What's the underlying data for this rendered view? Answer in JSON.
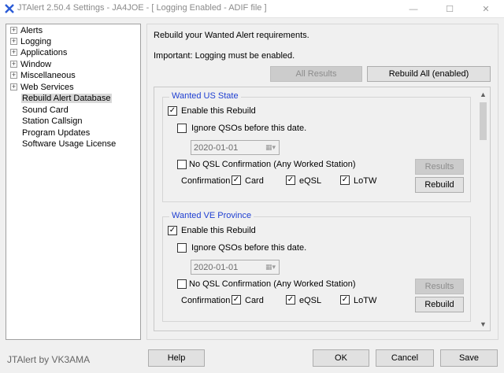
{
  "window": {
    "title": "JTAlert 2.50.4 Settings  -  JA4JOE  -  [ Logging Enabled - ADIF file ]",
    "minimize": "—",
    "maximize": "☐",
    "close": "✕"
  },
  "tree": {
    "items": [
      {
        "label": "Alerts",
        "expandable": true
      },
      {
        "label": "Logging",
        "expandable": true
      },
      {
        "label": "Applications",
        "expandable": true
      },
      {
        "label": "Window",
        "expandable": true
      },
      {
        "label": "Miscellaneous",
        "expandable": true
      },
      {
        "label": "Web Services",
        "expandable": true
      },
      {
        "label": "Rebuild Alert Database",
        "expandable": false,
        "selected": true
      },
      {
        "label": "Sound Card",
        "expandable": false
      },
      {
        "label": "Station Callsign",
        "expandable": false
      },
      {
        "label": "Program Updates",
        "expandable": false
      },
      {
        "label": "Software Usage License",
        "expandable": false
      }
    ],
    "expander": "+"
  },
  "panel": {
    "intro": "Rebuild your Wanted Alert requirements.",
    "important": "Important: Logging must be enabled.",
    "all_results_label": "All Results",
    "rebuild_all_label": "Rebuild All (enabled)"
  },
  "groups": [
    {
      "title": "Wanted US State",
      "enable_label": "Enable this Rebuild",
      "enable_checked": true,
      "ignore_label": "Ignore QSOs before this date.",
      "ignore_checked": false,
      "date_value": "2020-01-01",
      "no_qsl_label": "No QSL Confirmation (Any Worked Station)",
      "no_qsl_checked": false,
      "confirmation_label": "Confirmation",
      "card_label": "Card",
      "card_checked": true,
      "eqsl_label": "eQSL",
      "eqsl_checked": true,
      "lotw_label": "LoTW",
      "lotw_checked": true,
      "results_label": "Results",
      "rebuild_label": "Rebuild"
    },
    {
      "title": "Wanted VE Province",
      "enable_label": "Enable this Rebuild",
      "enable_checked": true,
      "ignore_label": "Ignore QSOs before this date.",
      "ignore_checked": false,
      "date_value": "2020-01-01",
      "no_qsl_label": "No QSL Confirmation (Any Worked Station)",
      "no_qsl_checked": false,
      "confirmation_label": "Confirmation",
      "card_label": "Card",
      "card_checked": true,
      "eqsl_label": "eQSL",
      "eqsl_checked": true,
      "lotw_label": "LoTW",
      "lotw_checked": true,
      "results_label": "Results",
      "rebuild_label": "Rebuild"
    }
  ],
  "footer": {
    "brand": "JTAlert by VK3AMA",
    "help_label": "Help",
    "ok_label": "OK",
    "cancel_label": "Cancel",
    "save_label": "Save"
  },
  "colors": {
    "group_title": "#1f3fd1",
    "app_icon": "#2a5bd7"
  }
}
